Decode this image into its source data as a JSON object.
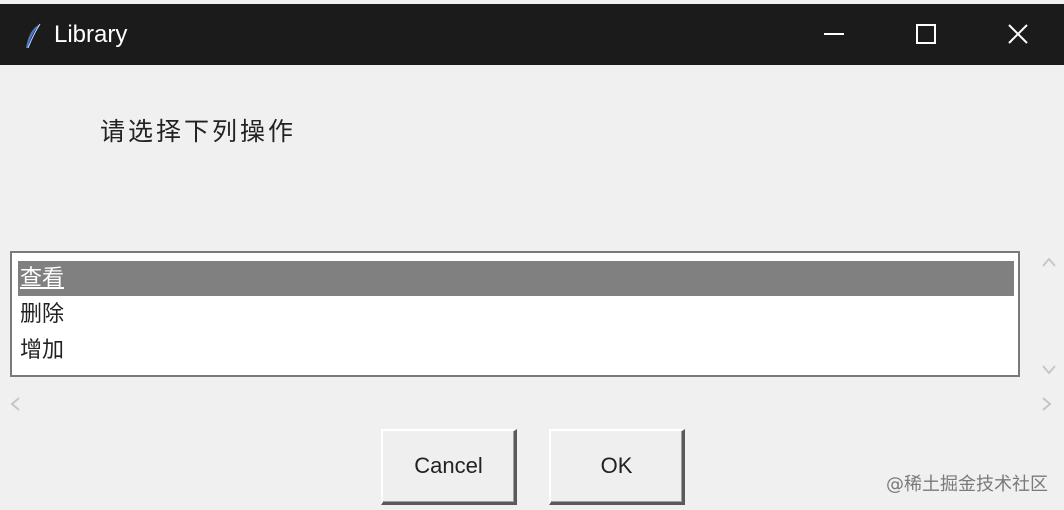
{
  "window": {
    "title": "Library"
  },
  "dialog": {
    "prompt": "请选择下列操作"
  },
  "listbox": {
    "items": [
      {
        "label": "查看",
        "selected": true
      },
      {
        "label": "删除",
        "selected": false
      },
      {
        "label": "增加",
        "selected": false
      }
    ]
  },
  "buttons": {
    "cancel_label": "Cancel",
    "ok_label": "OK"
  },
  "watermark": {
    "text": "@稀土掘金技术社区"
  },
  "colors": {
    "titlebar": "#1b1b1b",
    "window_bg": "#f0f0f0",
    "selection": "#808080",
    "list_bg": "#ffffff"
  },
  "icons": {
    "app": "feather-icon",
    "minimize": "minimize-icon",
    "maximize": "maximize-icon",
    "close": "close-icon"
  }
}
